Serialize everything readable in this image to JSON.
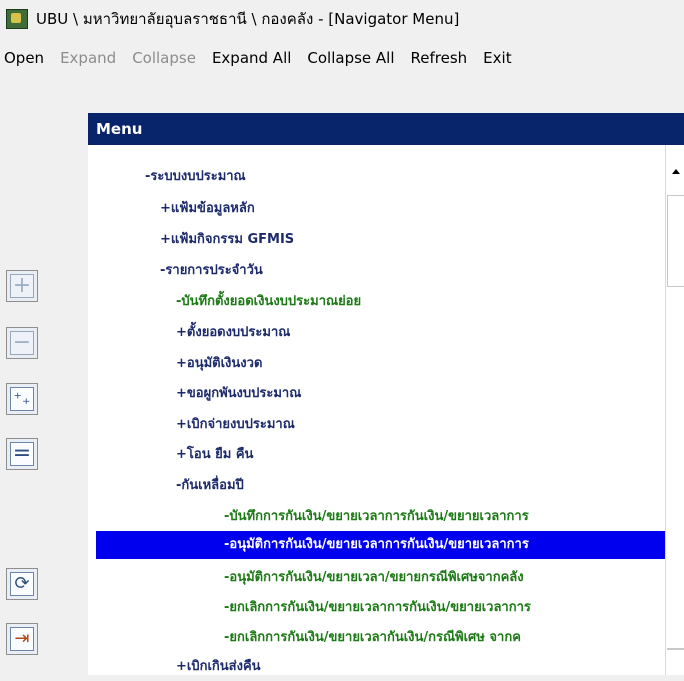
{
  "window": {
    "title": "UBU \\ มหาวิทยาลัยอุบลราชธานี \\ กองคลัง - [Navigator Menu]"
  },
  "menubar": {
    "items": [
      {
        "label": "Open",
        "enabled": true
      },
      {
        "label": "Expand",
        "enabled": false
      },
      {
        "label": "Collapse",
        "enabled": false
      },
      {
        "label": "Expand All",
        "enabled": true
      },
      {
        "label": "Collapse All",
        "enabled": true
      },
      {
        "label": "Refresh",
        "enabled": true
      },
      {
        "label": "Exit",
        "enabled": true
      }
    ]
  },
  "panel": {
    "header": "Menu"
  },
  "tree": {
    "nodes": [
      {
        "prefix": "- ",
        "label": "ระบบงบประมาณ",
        "kind": "folder"
      },
      {
        "prefix": "+ ",
        "label": "แฟ้มข้อมูลหลัก",
        "kind": "folder"
      },
      {
        "prefix": "+ ",
        "label": "แฟ้มกิจกรรม GFMIS",
        "kind": "folder"
      },
      {
        "prefix": "- ",
        "label": "รายการประจำวัน",
        "kind": "folder"
      },
      {
        "prefix": "- ",
        "label": "บันทึกตั้งยอดเงินงบประมาณย่อย",
        "kind": "leaf"
      },
      {
        "prefix": "+ ",
        "label": "ตั้งยอดงบประมาณ",
        "kind": "folder"
      },
      {
        "prefix": "+ ",
        "label": "อนุมัติเงินงวด",
        "kind": "folder"
      },
      {
        "prefix": "+ ",
        "label": "ขอผูกพันงบประมาณ",
        "kind": "folder"
      },
      {
        "prefix": "+ ",
        "label": "เบิกจ่ายงบประมาณ",
        "kind": "folder"
      },
      {
        "prefix": "+ ",
        "label": "โอน ยืม คืน",
        "kind": "folder"
      },
      {
        "prefix": "- ",
        "label": "กันเหลื่อมปี",
        "kind": "folder"
      },
      {
        "prefix": "- ",
        "label": "บันทึกการกันเงิน/ขยายเวลาการกันเงิน/ขยายเวลาการ",
        "kind": "leaf"
      },
      {
        "prefix": "- ",
        "label": "อนุมัติการกันเงิน/ขยายเวลาการกันเงิน/ขยายเวลาการ",
        "kind": "leaf",
        "selected": true
      },
      {
        "prefix": "- ",
        "label": "อนุมัติการกันเงิน/ขยายเวลา/ขยายกรณีพิเศษจากคลัง",
        "kind": "leaf"
      },
      {
        "prefix": "- ",
        "label": "ยกเลิกการกันเงิน/ขยายเวลาการกันเงิน/ขยายเวลาการ",
        "kind": "leaf"
      },
      {
        "prefix": "- ",
        "label": "ยกเลิกการกันเงิน/ขยายเวลากันเงิน/กรณีพิเศษ จากค",
        "kind": "leaf"
      },
      {
        "prefix": "+ ",
        "label": "เบิกเกินส่งคืน",
        "kind": "folder"
      }
    ]
  },
  "toolbar": {
    "buttons": [
      {
        "icon": "plus-icon",
        "glyph": "+",
        "enabled": false
      },
      {
        "icon": "minus-icon",
        "glyph": "−",
        "enabled": false
      },
      {
        "icon": "expand-all-icon",
        "glyph": "⁺₊",
        "enabled": true
      },
      {
        "icon": "collapse-all-icon",
        "glyph": "=",
        "enabled": true
      },
      {
        "icon": "refresh-icon",
        "glyph": "⟳",
        "enabled": true
      },
      {
        "icon": "exit-icon",
        "glyph": "⇥",
        "enabled": true
      }
    ]
  },
  "colors": {
    "header_bg": "#08246b",
    "selection_bg": "#0000ee",
    "folder_text": "#1d2b6b",
    "leaf_text": "#1c7a15"
  }
}
